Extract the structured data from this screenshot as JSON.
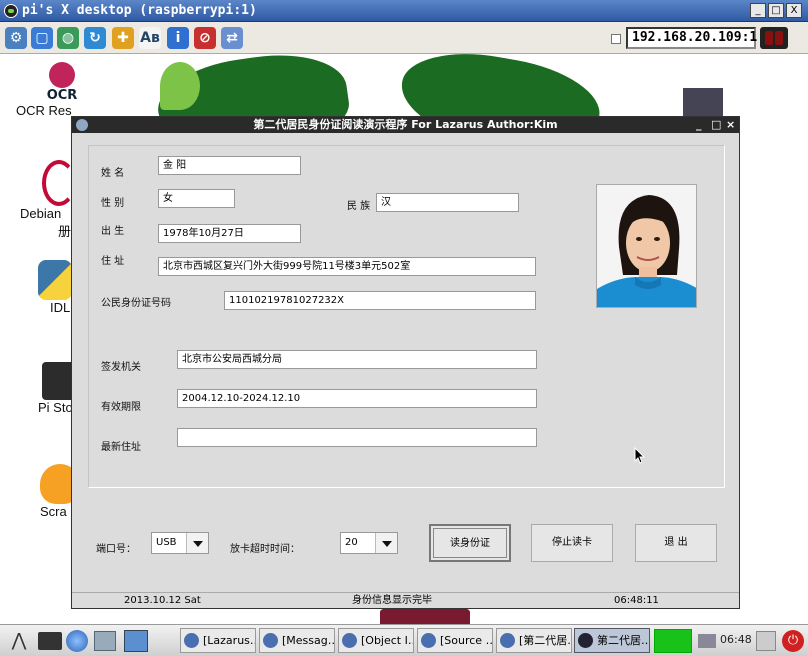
{
  "vnc": {
    "title": "pi's X desktop (raspberrypi:1)",
    "controls": {
      "minimize": "_",
      "maximize": "□",
      "close": "X"
    },
    "ip": "192.168.20.109:1",
    "toolbar_icons": [
      "connection-options-icon",
      "new-window-icon",
      "globe-refresh-icon",
      "refresh-icon",
      "puzzle-icon",
      "text-abc-icon",
      "info-icon",
      "disconnect-icon",
      "transfer-icon"
    ]
  },
  "desktop": {
    "icons": [
      {
        "label": "OCR Res"
      },
      {
        "label": "Debian"
      },
      {
        "label": "册"
      },
      {
        "label": "IDL"
      },
      {
        "label": "Pi Sto"
      },
      {
        "label": "Scra"
      }
    ],
    "ocr_logo": "OCR"
  },
  "app": {
    "title": "第二代居民身份证阅读演示程序  For Lazarus Author:Kim",
    "controls": {
      "minimize": "_",
      "maximize": "□",
      "close": "×"
    },
    "labels": {
      "name": "姓 名",
      "gender": "性 别",
      "ethnicity": "民 族",
      "birth": "出 生",
      "address": "住 址",
      "id_number": "公民身份证号码",
      "authority": "签发机关",
      "validity": "有效期限",
      "new_address": "最新住址",
      "port": "端口号：",
      "timeout": "放卡超时时间："
    },
    "values": {
      "name": "金  阳",
      "gender": "女",
      "ethnicity": "汉",
      "birth": "1978年10月27日",
      "address": "北京市西城区复兴门外大街999号院11号楼3单元502室",
      "id_number": "11010219781027232X",
      "authority": "北京市公安局西城分局",
      "validity": "2004.12.10-2024.12.10",
      "new_address": ""
    },
    "port_value": "USB",
    "timeout_value": "20",
    "buttons": {
      "read": "读身份证",
      "stop": "停止读卡",
      "exit": "退 出"
    },
    "status": {
      "date": "2013.10.12  Sat",
      "message": "身份信息显示完毕",
      "time": "06:48:11"
    }
  },
  "taskbar": {
    "tasks": [
      {
        "label": "[Lazarus…"
      },
      {
        "label": "[Messag…"
      },
      {
        "label": "[Object I…"
      },
      {
        "label": "[Source …"
      },
      {
        "label": "[第二代居…"
      },
      {
        "label": "第二代居…"
      }
    ],
    "clock": "06:48"
  }
}
